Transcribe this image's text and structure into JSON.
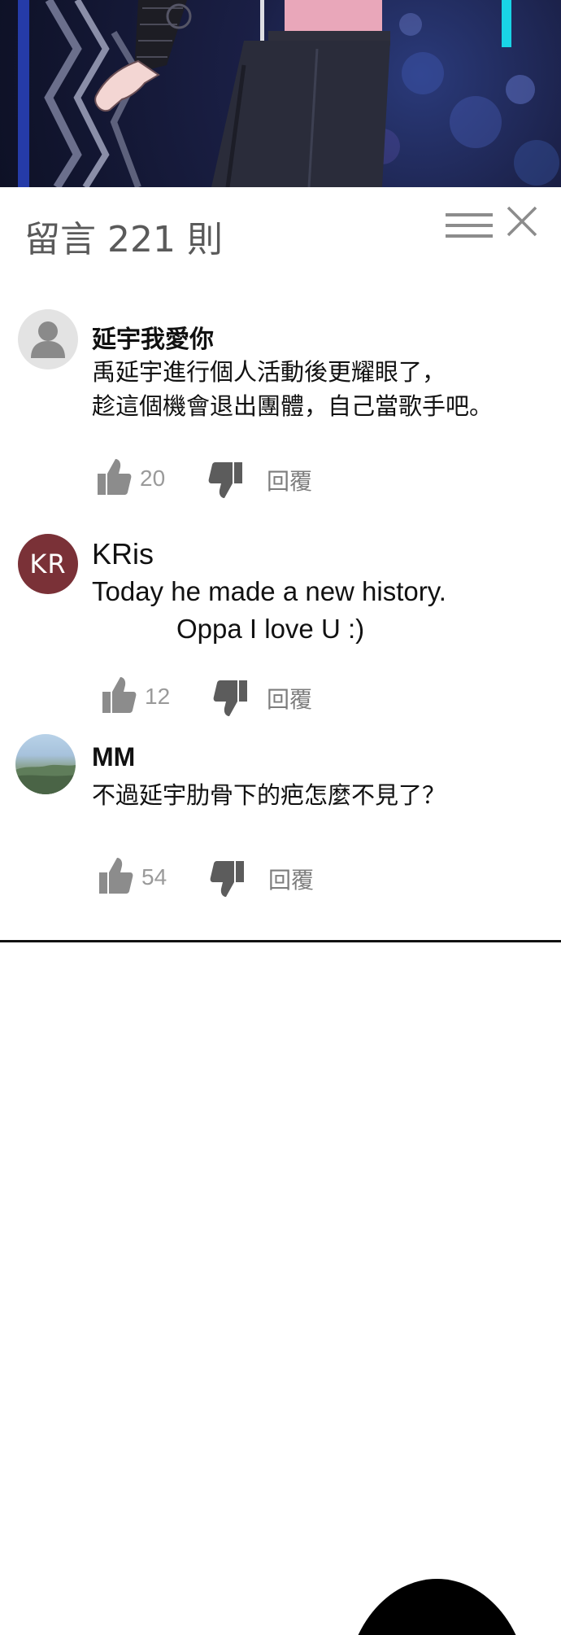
{
  "header": {
    "title": "留言 221 則"
  },
  "icons": {
    "menu": "menu-icon",
    "close": "close-icon",
    "like": "thumbs-up-icon",
    "dislike": "thumbs-down-icon",
    "default_avatar": "user-icon"
  },
  "colors": {
    "title_gray": "#5a5a5a",
    "count_gray": "#9a9a9a",
    "icon_gray": "#8c8c8c",
    "avatar_kr": "#7a3137"
  },
  "comments": [
    {
      "author": "延宇我愛你",
      "avatar_type": "default",
      "lines": [
        "禹延宇進行個人活動後更耀眼了，",
        "趁這個機會退出團體，自己當歌手吧。"
      ],
      "likes": "20",
      "reply_label": "回覆"
    },
    {
      "author": "KRis",
      "avatar_type": "initials",
      "avatar_text": "KR",
      "lines": [
        "Today he made a new history.",
        "Oppa I love U :)"
      ],
      "likes": "12",
      "reply_label": "回覆"
    },
    {
      "author": "MM",
      "avatar_type": "photo",
      "lines": [
        "不過延宇肋骨下的疤怎麼不見了？"
      ],
      "likes": "54",
      "reply_label": "回覆"
    }
  ]
}
